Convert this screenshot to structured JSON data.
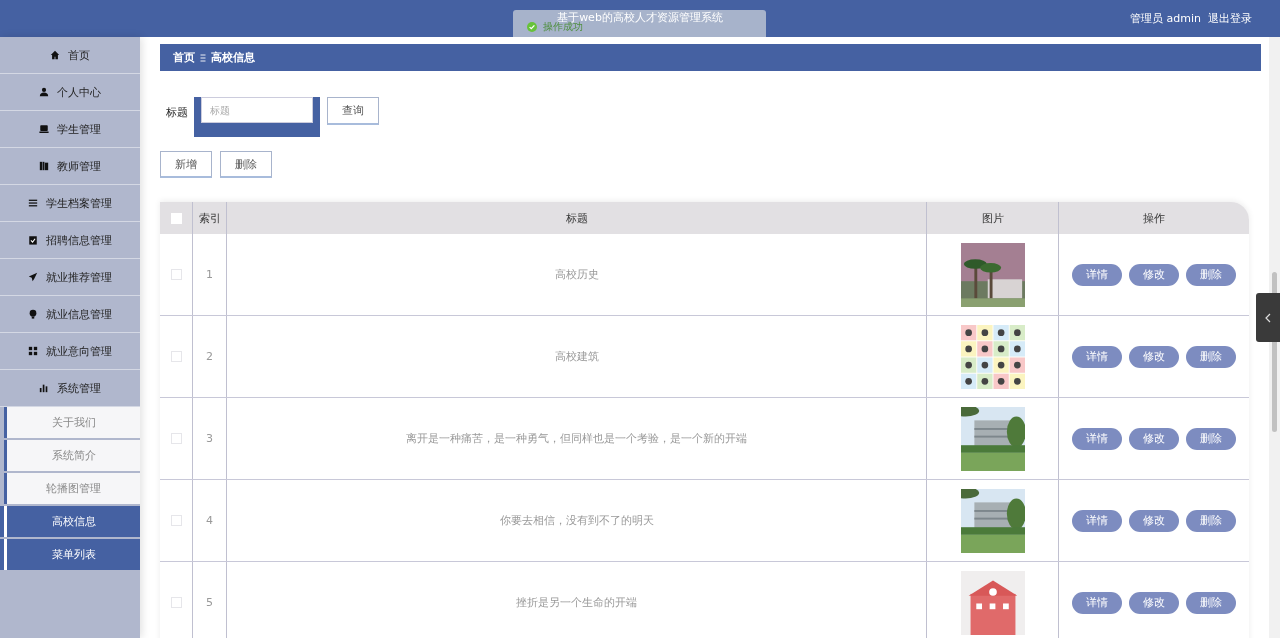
{
  "header": {
    "title": "基于web的高校人才资源管理系统",
    "user": "管理员 admin",
    "logout": "退出登录"
  },
  "toast": {
    "message": "操作成功"
  },
  "sidebar": {
    "items": [
      {
        "label": "首页"
      },
      {
        "label": "个人中心"
      },
      {
        "label": "学生管理"
      },
      {
        "label": "教师管理"
      },
      {
        "label": "学生档案管理"
      },
      {
        "label": "招聘信息管理"
      },
      {
        "label": "就业推荐管理"
      },
      {
        "label": "就业信息管理"
      },
      {
        "label": "就业意向管理"
      },
      {
        "label": "系统管理",
        "children": [
          {
            "label": "关于我们",
            "selected": false
          },
          {
            "label": "系统简介",
            "selected": false
          },
          {
            "label": "轮播图管理",
            "selected": false
          },
          {
            "label": "高校信息",
            "selected": true
          },
          {
            "label": "菜单列表",
            "selected": true
          }
        ]
      }
    ]
  },
  "breadcrumb": [
    "首页",
    "高校信息"
  ],
  "search": {
    "label": "标题",
    "placeholder": "标题",
    "button": "查询"
  },
  "actions": [
    "新增",
    "删除"
  ],
  "table": {
    "select_all": {
      "checked": false
    },
    "columns": [
      "索引",
      "标题",
      "图片",
      "操作"
    ],
    "rows": [
      {
        "checked": false,
        "index": "1",
        "title": "高校历史",
        "image": {
          "kind": "picture"
        },
        "actions": [
          "详情",
          "修改",
          "删除"
        ]
      },
      {
        "checked": false,
        "index": "2",
        "title": "高校建筑",
        "image": {
          "kind": "picture"
        },
        "actions": [
          "详情",
          "修改",
          "删除"
        ]
      },
      {
        "checked": false,
        "index": "3",
        "title": "离开是一种痛苦，是一种勇气，但同样也是一个考验，是一个新的开端",
        "image": {
          "kind": "picture"
        },
        "actions": [
          "详情",
          "修改",
          "删除"
        ]
      },
      {
        "checked": false,
        "index": "4",
        "title": "你要去相信，没有到不了的明天",
        "image": {
          "kind": "picture"
        },
        "actions": [
          "详情",
          "修改",
          "删除"
        ]
      },
      {
        "checked": false,
        "index": "5",
        "title": "挫折是另一个生命的开端",
        "image": {
          "kind": "picture"
        },
        "actions": [
          "详情",
          "修改",
          "删除"
        ]
      }
    ]
  }
}
